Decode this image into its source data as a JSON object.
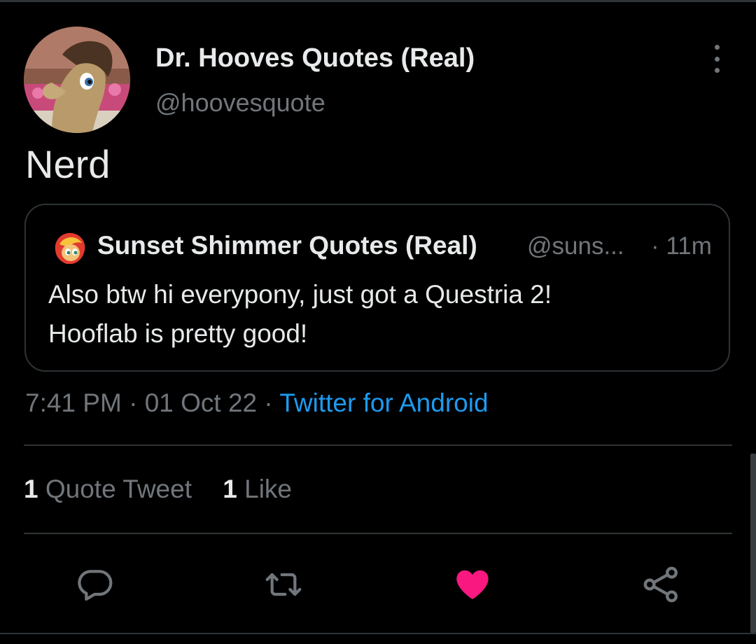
{
  "tweet": {
    "author_name": "Dr. Hooves Quotes (Real)",
    "author_handle": "@hoovesquote",
    "text": "Nerd",
    "avatar_icon": "pony-avatar"
  },
  "quoted": {
    "author_name": "Sunset Shimmer Quotes (Real)",
    "author_handle": "@suns...",
    "time": "· 11m",
    "line1": "Also btw hi everypony, just got a Questria 2!",
    "line2": "Hooflab is pretty good!"
  },
  "meta": {
    "time": "7:41 PM",
    "sep1": " · ",
    "date": "01 Oct 22",
    "sep2": " · ",
    "source": "Twitter for Android"
  },
  "stats": {
    "quote_count": "1",
    "quote_label": "Quote Tweet",
    "like_count": "1",
    "like_label": "Like"
  },
  "actions": {
    "reply_icon": "reply-icon",
    "retweet_icon": "retweet-icon",
    "like_icon": "heart-icon",
    "share_icon": "share-icon"
  },
  "colors": {
    "background": "#000000",
    "text": "#e7e9ea",
    "secondary": "#71767b",
    "link": "#1d9bf0",
    "like": "#f91880",
    "border": "#2f3336"
  }
}
